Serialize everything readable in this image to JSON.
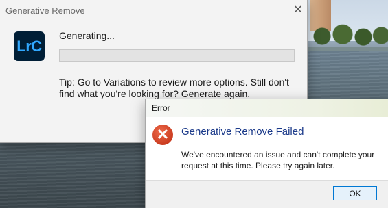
{
  "main_dialog": {
    "title": "Generative Remove",
    "close_icon": "✕",
    "logo_text": "LrC",
    "status": "Generating...",
    "progress": 0,
    "tip": "Tip: Go to Variations to review more options. Still don't find what you're looking for? Generate again."
  },
  "error_dialog": {
    "title": "Error",
    "icon": "✕",
    "heading": "Generative Remove Failed",
    "message": "We've encountered an issue and can't complete your request at this time. Please try again later.",
    "ok_label": "OK"
  },
  "colors": {
    "accent": "#0078d4",
    "heading": "#1b3a8a",
    "error_icon": "#d2452a",
    "logo_bg": "#001e36",
    "logo_fg": "#31a8ff"
  },
  "icons": {
    "close": "close-icon",
    "error": "error-icon",
    "app_logo": "lightroom-classic-logo"
  }
}
